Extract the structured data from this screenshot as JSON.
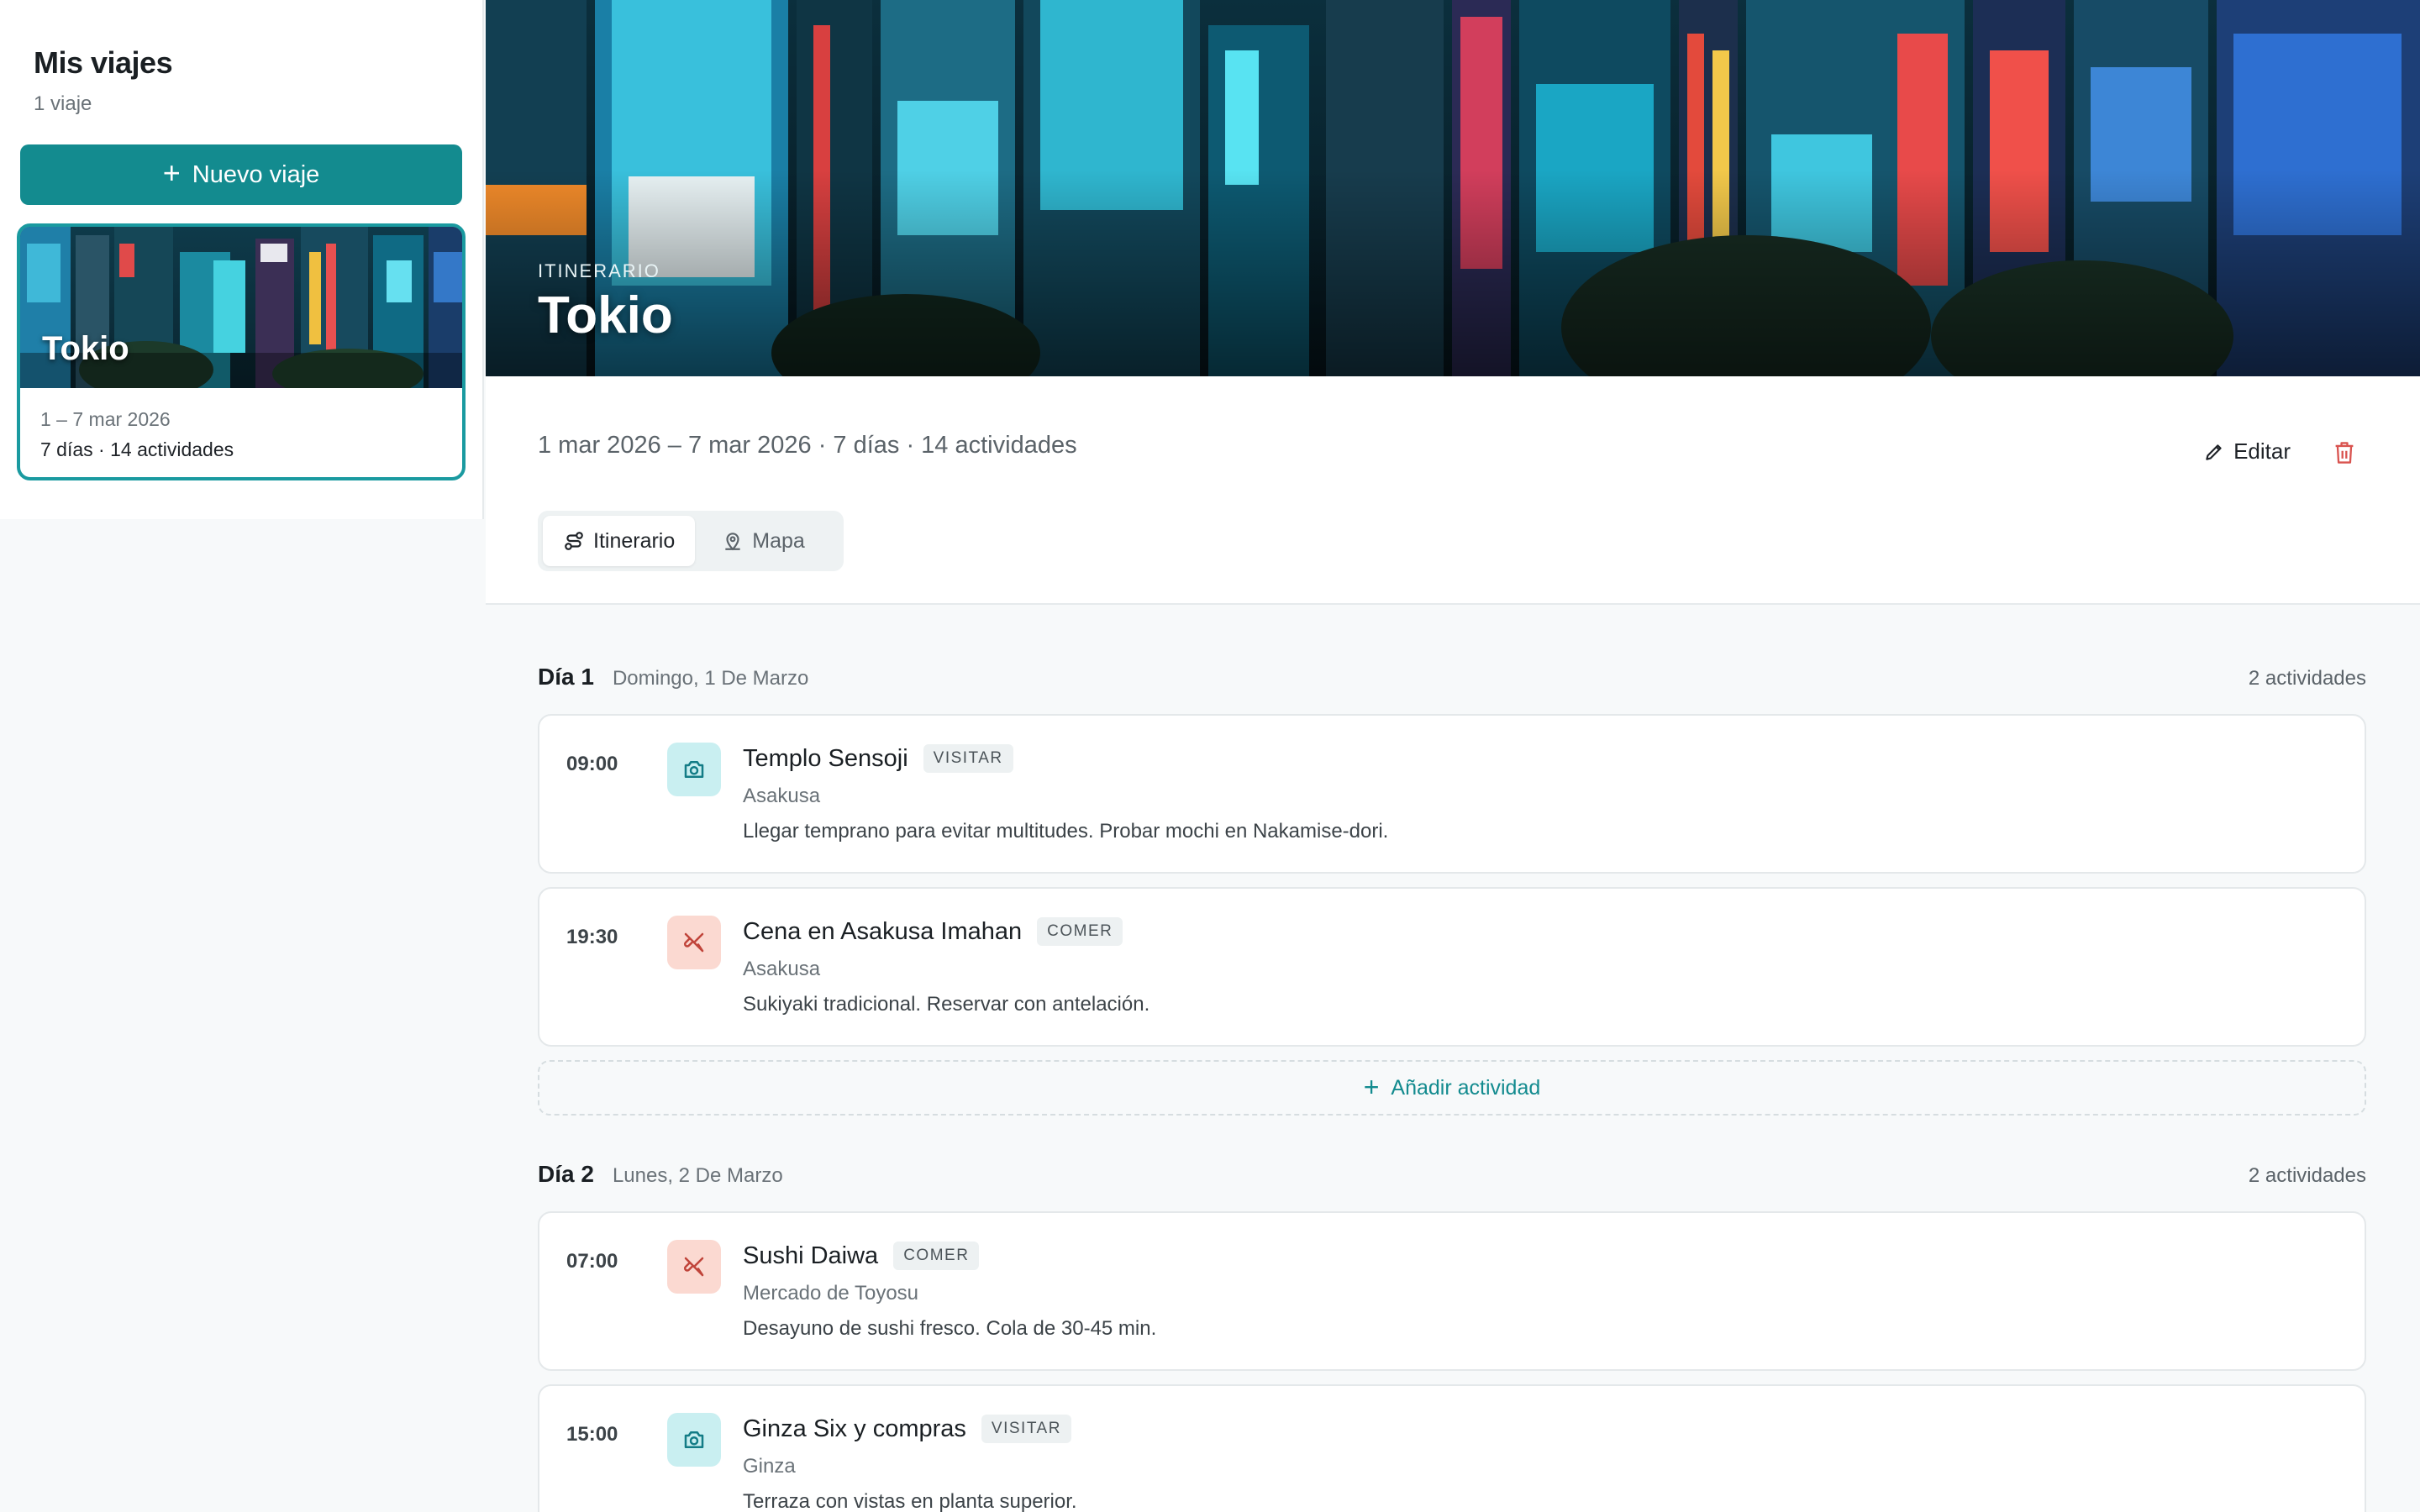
{
  "sidebar": {
    "title": "Mis viajes",
    "count": "1 viaje",
    "new_trip_label": "Nuevo viaje",
    "trips": [
      {
        "name": "Tokio",
        "dates": "1 – 7 mar 2026",
        "meta": "7 días · 14 actividades"
      }
    ]
  },
  "hero": {
    "eyebrow": "ITINERARIO",
    "title": "Tokio"
  },
  "trip": {
    "summary": "1 mar 2026 – 7 mar 2026 · 7 días · 14 actividades",
    "edit_label": "Editar",
    "tabs": [
      {
        "label": "Itinerario",
        "icon": "route-icon",
        "active": true
      },
      {
        "label": "Mapa",
        "icon": "map-pin-icon",
        "active": false
      }
    ]
  },
  "days": [
    {
      "label": "Día 1",
      "date": "Domingo, 1 De Marzo",
      "count": "2 actividades",
      "activities": [
        {
          "time": "09:00",
          "title": "Templo Sensoji",
          "tag": "VISITAR",
          "kind": "visit",
          "icon": "camera-icon",
          "place": "Asakusa",
          "note": "Llegar temprano para evitar multitudes. Probar mochi en Nakamise-dori."
        },
        {
          "time": "19:30",
          "title": "Cena en Asakusa Imahan",
          "tag": "COMER",
          "kind": "eat",
          "icon": "utensils-icon",
          "place": "Asakusa",
          "note": "Sukiyaki tradicional. Reservar con antelación."
        }
      ],
      "add_label": "Añadir actividad"
    },
    {
      "label": "Día 2",
      "date": "Lunes, 2 De Marzo",
      "count": "2 actividades",
      "activities": [
        {
          "time": "07:00",
          "title": "Sushi Daiwa",
          "tag": "COMER",
          "kind": "eat",
          "icon": "utensils-icon",
          "place": "Mercado de Toyosu",
          "note": "Desayuno de sushi fresco. Cola de 30-45 min."
        },
        {
          "time": "15:00",
          "title": "Ginza Six y compras",
          "tag": "VISITAR",
          "kind": "visit",
          "icon": "camera-icon",
          "place": "Ginza",
          "note": "Terraza con vistas en planta superior."
        }
      ]
    }
  ],
  "colors": {
    "accent": "#138b8f",
    "visit_bg": "#c9eff1",
    "eat_bg": "#fbd9d1",
    "delete": "#d9534f"
  }
}
